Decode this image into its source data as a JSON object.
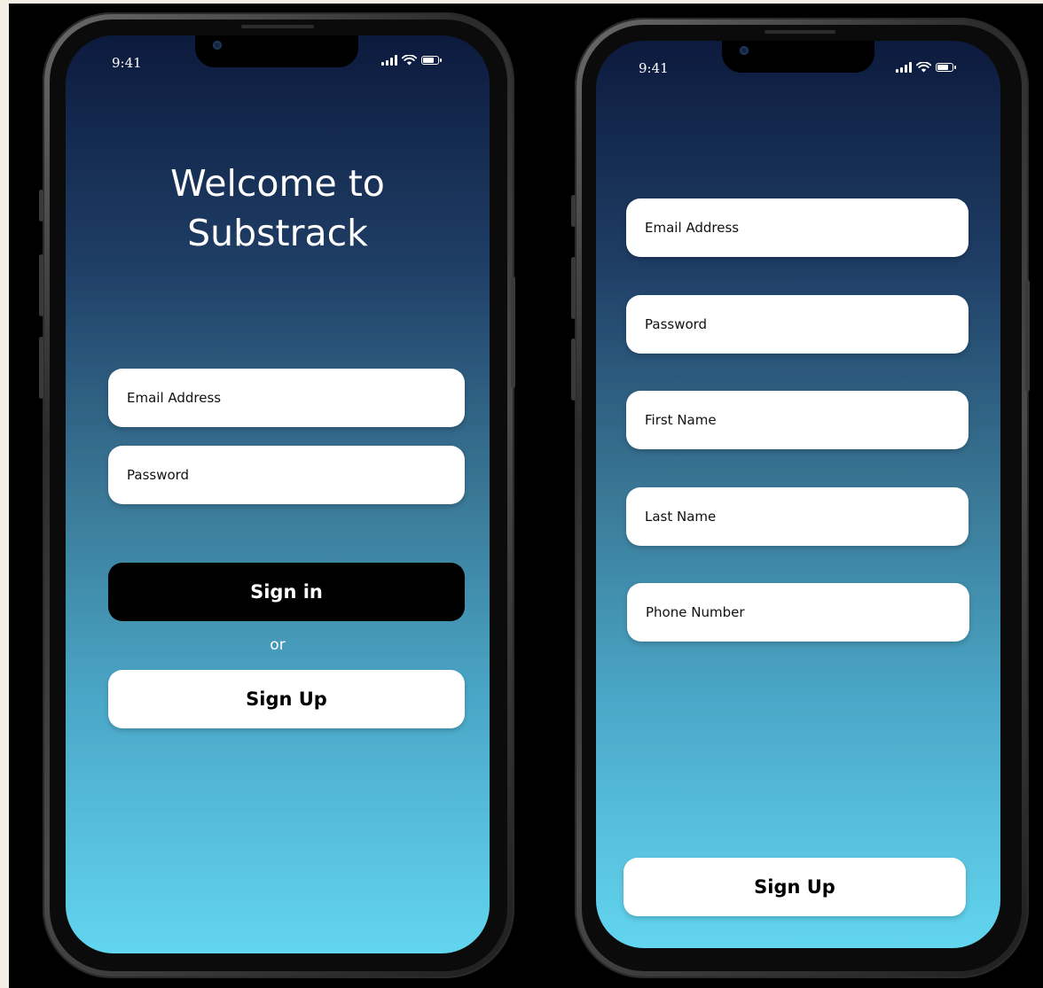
{
  "signin_screen": {
    "status_time": "9:41",
    "title_line1": "Welcome to",
    "title_line2": "Substrack",
    "email_placeholder": "Email Address",
    "password_placeholder": "Password",
    "signin_label": "Sign in",
    "or_text": "or",
    "signup_label": "Sign Up"
  },
  "signup_screen": {
    "status_time": "9:41",
    "email_placeholder": "Email Address",
    "password_placeholder": "Password",
    "first_name_placeholder": "First Name",
    "last_name_placeholder": "Last Name",
    "phone_placeholder": "Phone Number",
    "signup_label": "Sign Up"
  },
  "icons": {
    "signal": "cellular-signal-icon",
    "wifi": "wifi-icon",
    "battery": "battery-icon"
  },
  "colors": {
    "gradient_top": "#0c1a3d",
    "gradient_bottom": "#62d5ef",
    "primary_button": "#000000",
    "secondary_button": "#ffffff"
  }
}
